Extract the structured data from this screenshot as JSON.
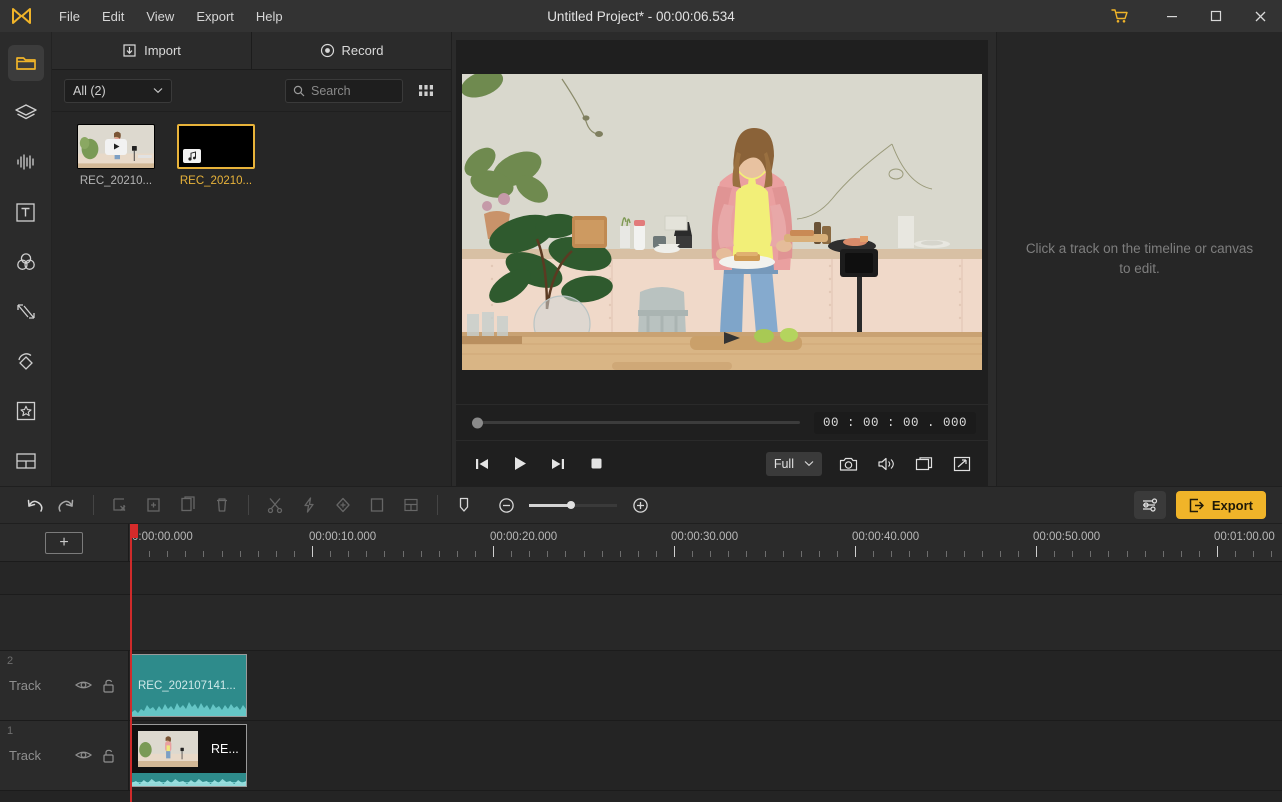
{
  "titlebar": {
    "app_logo": "videoproc-logo-icon",
    "project_title": "Untitled Project* - 00:00:06.534",
    "menus": [
      "File",
      "Edit",
      "View",
      "Export",
      "Help"
    ],
    "cart_icon": "shopping-cart-icon",
    "minimize_icon": "minimize-icon",
    "maximize_icon": "maximize-icon",
    "close_icon": "close-icon"
  },
  "rail": {
    "items": [
      {
        "name": "media-library",
        "icon": "folder-icon",
        "active": true
      },
      {
        "name": "layers",
        "icon": "layers-icon",
        "active": false
      },
      {
        "name": "audio",
        "icon": "waveform-icon",
        "active": false
      },
      {
        "name": "text",
        "icon": "text-box-icon",
        "active": false
      },
      {
        "name": "effects",
        "icon": "color-circles-icon",
        "active": false
      },
      {
        "name": "transitions",
        "icon": "transition-arrows-icon",
        "active": false
      },
      {
        "name": "rotate",
        "icon": "rotate-shape-icon",
        "active": false
      },
      {
        "name": "favorites",
        "icon": "star-box-icon",
        "active": false
      },
      {
        "name": "split-screen",
        "icon": "layout-grid-icon",
        "active": false
      }
    ]
  },
  "media_panel": {
    "tabs": [
      {
        "label": "Import",
        "icon": "import-icon"
      },
      {
        "label": "Record",
        "icon": "record-icon"
      }
    ],
    "filter": {
      "value": "All (2)",
      "chevron": "chevron-down-icon"
    },
    "search": {
      "placeholder": "Search",
      "value": "",
      "icon": "search-icon"
    },
    "view_toggle_icon": "grid-view-icon",
    "items": [
      {
        "name": "REC_20210...",
        "type": "video",
        "badge_icon": "play-icon",
        "selected": false
      },
      {
        "name": "REC_20210...",
        "type": "audio",
        "badge_icon": "music-note-icon",
        "selected": true
      }
    ]
  },
  "preview": {
    "scrubber": {
      "position_percent": 0
    },
    "timecode": "00 : 00 : 00 . 000",
    "transport": [
      {
        "name": "prev-frame",
        "icon": "step-back-icon"
      },
      {
        "name": "play",
        "icon": "play-icon"
      },
      {
        "name": "next-frame",
        "icon": "step-forward-icon"
      },
      {
        "name": "stop",
        "icon": "stop-icon"
      }
    ],
    "quality": {
      "value": "Full",
      "chevron": "chevron-down-icon"
    },
    "right_tools": [
      {
        "name": "snapshot",
        "icon": "camera-icon"
      },
      {
        "name": "volume",
        "icon": "speaker-icon"
      },
      {
        "name": "pop-out",
        "icon": "window-icon"
      },
      {
        "name": "fullscreen",
        "icon": "expand-icon"
      }
    ]
  },
  "properties": {
    "hint": "Click a track on the timeline or canvas to edit."
  },
  "toolbar": {
    "left": [
      {
        "name": "undo",
        "icon": "undo-arrow-icon",
        "disabled": false
      },
      {
        "name": "redo",
        "icon": "redo-arrow-icon",
        "disabled": false
      }
    ],
    "group2": [
      {
        "name": "delete-clip",
        "icon": "clip-delete-icon",
        "disabled": true
      },
      {
        "name": "add-clip",
        "icon": "clip-add-icon",
        "disabled": true
      },
      {
        "name": "copy-clip",
        "icon": "copy-icon",
        "disabled": true
      },
      {
        "name": "trash",
        "icon": "trash-icon",
        "disabled": true
      }
    ],
    "group3": [
      {
        "name": "cut",
        "icon": "scissors-icon",
        "disabled": true
      },
      {
        "name": "speed",
        "icon": "lightning-icon",
        "disabled": true
      },
      {
        "name": "keyframe",
        "icon": "diamond-icon",
        "disabled": true
      },
      {
        "name": "crop",
        "icon": "square-icon",
        "disabled": true
      },
      {
        "name": "split-screen",
        "icon": "layout-icon",
        "disabled": true
      }
    ],
    "group4": [
      {
        "name": "marker",
        "icon": "marker-icon",
        "disabled": false
      }
    ],
    "zoom": {
      "out_icon": "zoom-out-icon",
      "in_icon": "zoom-in-icon",
      "value_percent": 48
    },
    "settings_icon": "sliders-icon",
    "export_label": "Export",
    "export_icon": "export-arrow-icon",
    "export_color": "#f0b429"
  },
  "timeline": {
    "add_track_label": "+",
    "playhead_time": "00:00:00.000",
    "ruler_labels": [
      "0:00:00.000",
      "00:00:10.000",
      "00:00:20.000",
      "00:00:30.000",
      "00:00:40.000",
      "00:00:50.000",
      "00:01:00.00"
    ],
    "tracks": [
      {
        "number": "2",
        "label": "Track",
        "eye_icon": "eye-icon",
        "lock_icon": "unlock-icon",
        "clip": {
          "type": "audio",
          "name": "REC_202107141...",
          "color": "#2e8b8b"
        }
      },
      {
        "number": "1",
        "label": "Track",
        "eye_icon": "eye-icon",
        "lock_icon": "unlock-icon",
        "clip": {
          "type": "video",
          "name": "RE...",
          "color": "#2e8b8b"
        }
      }
    ]
  },
  "colors": {
    "accent": "#f0b429",
    "playhead": "#cf2b2b",
    "clip_teal": "#2e8b8b",
    "panel_bg": "#262626",
    "chrome_bg": "#2b2b2b"
  }
}
